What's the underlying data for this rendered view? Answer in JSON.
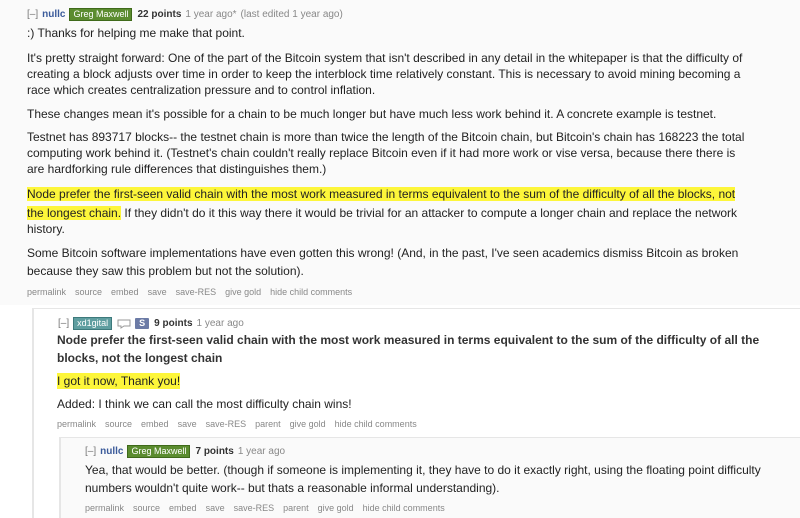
{
  "c1": {
    "collapse": "[–]",
    "author": "nullc",
    "flair": "Greg Maxwell",
    "points": "22 points",
    "time": "1 year ago*",
    "edited": "(last edited 1 year ago)",
    "p1": ":) Thanks for helping me make that point.",
    "p2_l1": "It's pretty straight forward: One of the part of the Bitcoin system that isn't described in any detail in the whitepaper is that the difficulty of",
    "p2_l2": "creating a block adjusts over time in order to keep the interblock time relatively constant. This is necessary to avoid mining becoming a",
    "p2_l3": "race which creates centralization pressure and to control inflation.",
    "p3": "These changes mean it's possible for a chain to be much longer but have much less work behind it. A concrete example is testnet.",
    "p4_l1": "Testnet has 893717 blocks-- the testnet chain is more than twice the length of the Bitcoin chain, but Bitcoin's chain has 168223 the total",
    "p4_l2": "computing work behind it. (Testnet's chain couldn't really replace Bitcoin even if it had more work or vise versa, because there there is",
    "p4_l3": "are hardforking rule differences that distinguishes them.)",
    "p5_l1_hl": "Node prefer the first-seen valid chain with the most work measured in terms equivalent to the sum of the difficulty of all the blocks, not",
    "p5_l2_hl": "the longest chain.",
    "p5_l2_rest": " If they didn't do it this way there it would be trivial for an attacker to compute a longer chain and replace the network",
    "p5_l3": "history.",
    "p6_l1": "Some Bitcoin software implementations have even gotten this wrong! (And, in the past, I've seen academics dismiss Bitcoin as broken",
    "p6_l2": "because they saw this problem but not the solution).",
    "links": [
      "permalink",
      "source",
      "embed",
      "save",
      "save-RES",
      "give gold",
      "hide child comments"
    ]
  },
  "c2": {
    "collapse": "[–]",
    "author": "xd1gital",
    "badge": "S",
    "points": "9 points",
    "time": "1 year ago",
    "quote_l1": "Node prefer the first-seen valid chain with the most work measured in terms equivalent to the sum of the difficulty of all the",
    "quote_l2": "blocks, not the longest chain",
    "p1_hl": "I got it now, Thank you!",
    "p2": "Added: I think we can call the most difficulty chain wins!",
    "links": [
      "permalink",
      "source",
      "embed",
      "save",
      "save-RES",
      "parent",
      "give gold",
      "hide child comments"
    ]
  },
  "c3": {
    "collapse": "[–]",
    "author": "nullc",
    "flair": "Greg Maxwell",
    "points": "7 points",
    "time": "1 year ago",
    "p1_l1": "Yea, that would be better. (though if someone is implementing it, they have to do it exactly right, using the floating point difficulty",
    "p1_l2": "numbers wouldn't quite work-- but thats a reasonable informal understanding).",
    "links": [
      "permalink",
      "source",
      "embed",
      "save",
      "save-RES",
      "parent",
      "give gold",
      "hide child comments"
    ]
  }
}
